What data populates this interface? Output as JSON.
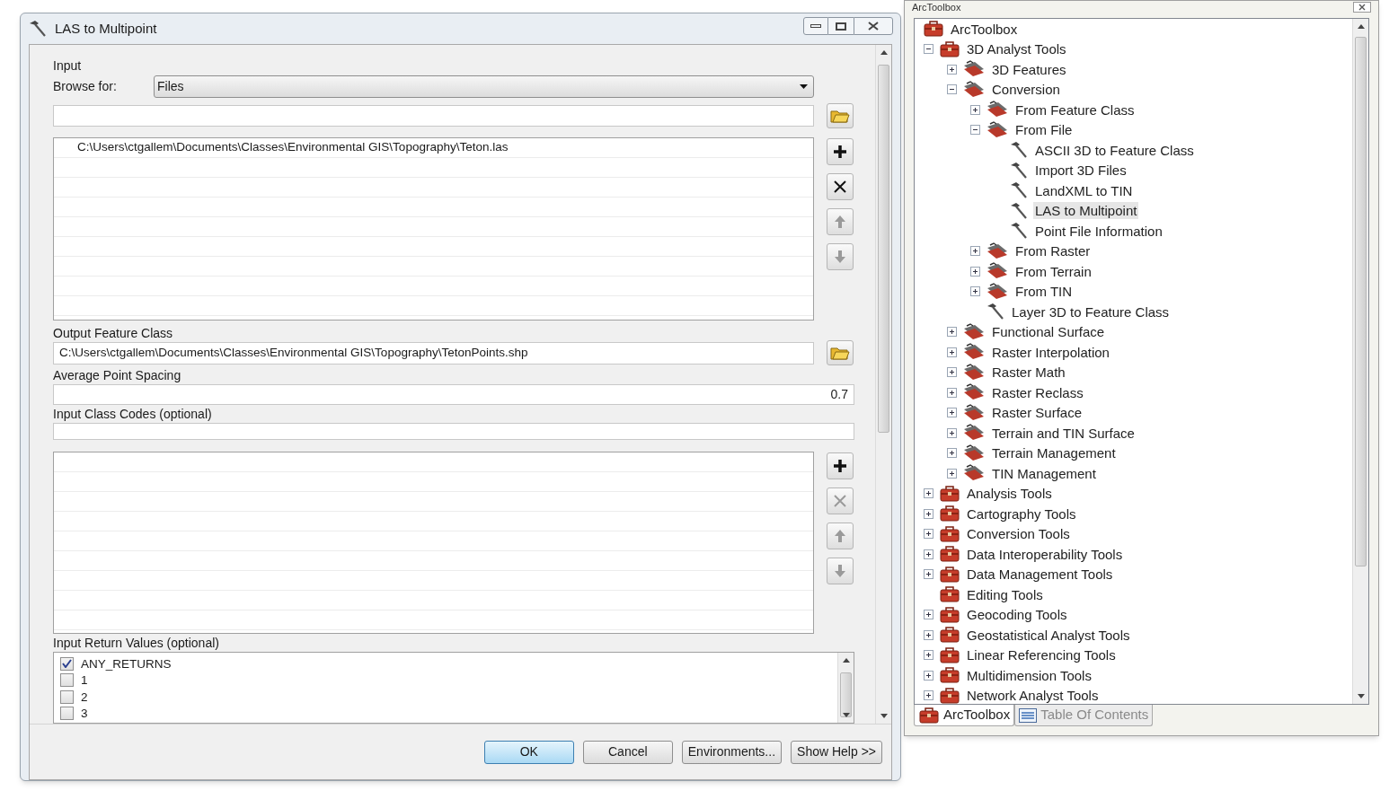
{
  "dialog": {
    "title": "LAS to Multipoint",
    "input_label": "Input",
    "browse_label": "Browse for:",
    "browse_value": "Files",
    "input_files": {
      "rows": [
        "C:\\Users\\ctgallem\\Documents\\Classes\\Environmental GIS\\Topography\\Teton.las"
      ],
      "buttons": [
        {
          "kind": "add",
          "disabled": false
        },
        {
          "kind": "remove",
          "disabled": false
        },
        {
          "kind": "up",
          "disabled": true
        },
        {
          "kind": "down",
          "disabled": true
        }
      ]
    },
    "output_label": "Output Feature Class",
    "output_value": "C:\\Users\\ctgallem\\Documents\\Classes\\Environmental GIS\\Topography\\TetonPoints.shp",
    "spacing_label": "Average Point Spacing",
    "spacing_value": "0.7",
    "class_codes_label": "Input Class Codes (optional)",
    "class_codes": {
      "buttons": [
        {
          "kind": "add",
          "disabled": false
        },
        {
          "kind": "remove",
          "disabled": true
        },
        {
          "kind": "up",
          "disabled": true
        },
        {
          "kind": "down",
          "disabled": true
        }
      ]
    },
    "return_values_label": "Input Return Values (optional)",
    "return_values": [
      {
        "label": "ANY_RETURNS",
        "checked": true
      },
      {
        "label": "1",
        "checked": false
      },
      {
        "label": "2",
        "checked": false
      },
      {
        "label": "3",
        "checked": false
      }
    ],
    "buttons": [
      {
        "label": "OK",
        "default": true
      },
      {
        "label": "Cancel",
        "default": false
      },
      {
        "label": "Environments...",
        "default": false
      },
      {
        "label": "Show Help >>",
        "default": false
      }
    ]
  },
  "toolbox_panel": {
    "title": "ArcToolbox",
    "tree": [
      {
        "label": "ArcToolbox",
        "kind": "root",
        "children": [
          {
            "label": "3D Analyst Tools",
            "kind": "toolbox",
            "expanded": true,
            "children": [
              {
                "label": "3D Features",
                "kind": "toolset",
                "expanded": false
              },
              {
                "label": "Conversion",
                "kind": "toolset",
                "expanded": true,
                "children": [
                  {
                    "label": "From Feature Class",
                    "kind": "toolset",
                    "expanded": false
                  },
                  {
                    "label": "From File",
                    "kind": "toolset",
                    "expanded": true,
                    "children": [
                      {
                        "label": "ASCII 3D to Feature Class",
                        "kind": "tool",
                        "selected": false
                      },
                      {
                        "label": "Import 3D Files",
                        "kind": "tool",
                        "selected": false
                      },
                      {
                        "label": "LandXML to TIN",
                        "kind": "tool",
                        "selected": false
                      },
                      {
                        "label": "LAS to Multipoint",
                        "kind": "tool",
                        "selected": true
                      },
                      {
                        "label": "Point File Information",
                        "kind": "tool",
                        "selected": false
                      }
                    ]
                  },
                  {
                    "label": "From Raster",
                    "kind": "toolset",
                    "expanded": false
                  },
                  {
                    "label": "From Terrain",
                    "kind": "toolset",
                    "expanded": false
                  },
                  {
                    "label": "From TIN",
                    "kind": "toolset",
                    "expanded": false
                  },
                  {
                    "label": "Layer 3D to Feature Class",
                    "kind": "tool",
                    "selected": false
                  }
                ]
              },
              {
                "label": "Functional Surface",
                "kind": "toolset",
                "expanded": false
              },
              {
                "label": "Raster Interpolation",
                "kind": "toolset",
                "expanded": false
              },
              {
                "label": "Raster Math",
                "kind": "toolset",
                "expanded": false
              },
              {
                "label": "Raster Reclass",
                "kind": "toolset",
                "expanded": false
              },
              {
                "label": "Raster Surface",
                "kind": "toolset",
                "expanded": false
              },
              {
                "label": "Terrain and TIN Surface",
                "kind": "toolset",
                "expanded": false
              },
              {
                "label": "Terrain Management",
                "kind": "toolset",
                "expanded": false
              },
              {
                "label": "TIN Management",
                "kind": "toolset",
                "expanded": false
              }
            ]
          },
          {
            "label": "Analysis Tools",
            "kind": "toolbox",
            "expanded": false
          },
          {
            "label": "Cartography Tools",
            "kind": "toolbox",
            "expanded": false
          },
          {
            "label": "Conversion Tools",
            "kind": "toolbox",
            "expanded": false
          },
          {
            "label": "Data Interoperability Tools",
            "kind": "toolbox",
            "expanded": false
          },
          {
            "label": "Data Management Tools",
            "kind": "toolbox",
            "expanded": false
          },
          {
            "label": "Editing Tools",
            "kind": "toolbox"
          },
          {
            "label": "Geocoding Tools",
            "kind": "toolbox",
            "expanded": false
          },
          {
            "label": "Geostatistical Analyst Tools",
            "kind": "toolbox",
            "expanded": false
          },
          {
            "label": "Linear Referencing Tools",
            "kind": "toolbox",
            "expanded": false
          },
          {
            "label": "Multidimension Tools",
            "kind": "toolbox",
            "expanded": false
          },
          {
            "label": "Network Analyst Tools",
            "kind": "toolbox",
            "expanded": false
          }
        ]
      }
    ],
    "tabs": [
      {
        "label": "ArcToolbox",
        "kind": "toolbox",
        "selected": true
      },
      {
        "label": "Table Of Contents",
        "kind": "contents",
        "selected": false
      }
    ]
  }
}
